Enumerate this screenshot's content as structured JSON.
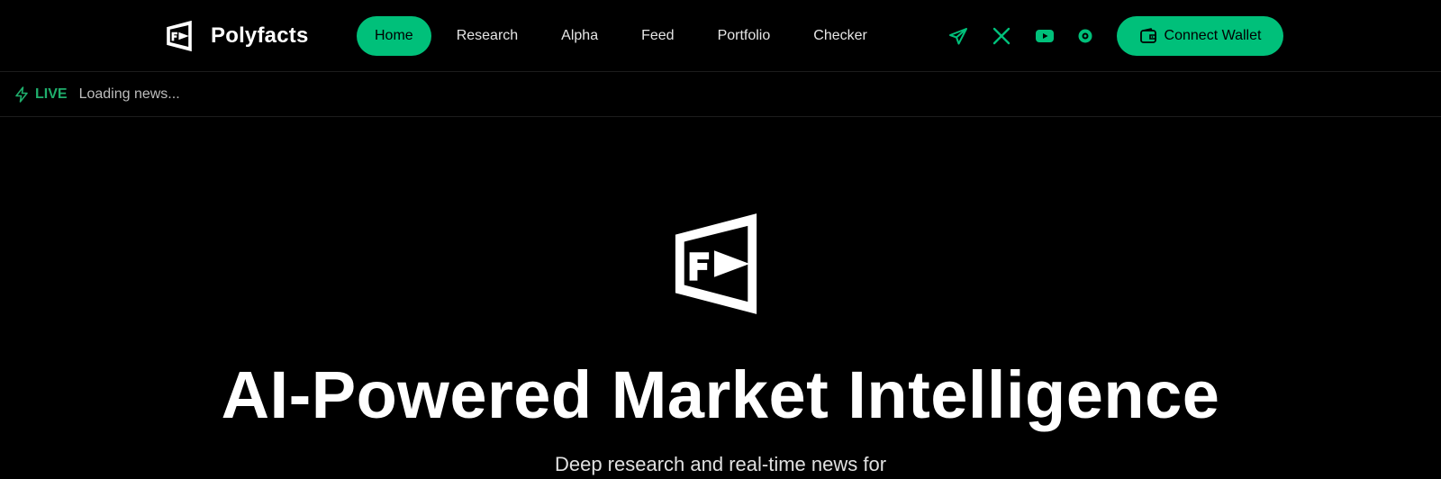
{
  "brand": {
    "name": "Polyfacts",
    "logo_icon": "polyfacts-logo-icon"
  },
  "nav": {
    "items": [
      {
        "label": "Home",
        "active": true
      },
      {
        "label": "Research",
        "active": false
      },
      {
        "label": "Alpha",
        "active": false
      },
      {
        "label": "Feed",
        "active": false
      },
      {
        "label": "Portfolio",
        "active": false
      },
      {
        "label": "Checker",
        "active": false
      }
    ]
  },
  "social": [
    "telegram-icon",
    "x-icon",
    "youtube-icon",
    "gitbook-icon"
  ],
  "wallet": {
    "label": "Connect Wallet",
    "icon": "wallet-icon"
  },
  "ticker": {
    "live_label": "LIVE",
    "text": "Loading news...",
    "icon": "bolt-icon"
  },
  "hero": {
    "logo_icon": "polyfacts-logo-icon",
    "title": "AI-Powered Market Intelligence",
    "subtitle": "Deep research and real-time news for"
  },
  "colors": {
    "accent": "#00c07a",
    "live": "#1fae6c",
    "background": "#000000",
    "text": "#ffffff"
  }
}
